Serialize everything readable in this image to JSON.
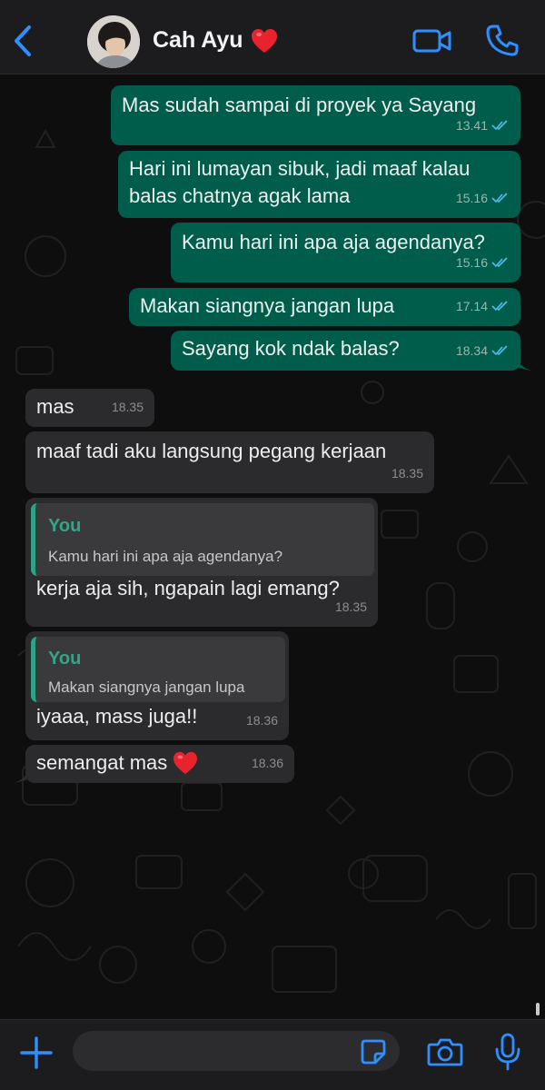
{
  "colors": {
    "accent": "#2e8fff",
    "outgoing_bubble": "#005c4b",
    "incoming_bubble": "#2b2b2d",
    "quote_author": "#35a488",
    "read_ticks": "#53bdeb"
  },
  "header": {
    "contact_name": "Cah Ayu",
    "back_icon": "chevron-left-icon",
    "video_icon": "video-camera-icon",
    "call_icon": "phone-icon"
  },
  "messages": [
    {
      "dir": "out",
      "text": "Mas sudah sampai di proyek ya Sayang",
      "time": "13.41"
    },
    {
      "dir": "out",
      "text": "Hari ini lumayan sibuk, jadi maaf kalau",
      "text2": "balas chatnya agak lama",
      "time": "15.16"
    },
    {
      "dir": "out",
      "text": "Kamu hari ini apa aja agendanya?",
      "time": "15.16"
    },
    {
      "dir": "out",
      "text": "Makan siangnya jangan lupa",
      "time": "17.14"
    },
    {
      "dir": "out",
      "text": "Sayang kok ndak balas?",
      "time": "18.34"
    },
    {
      "dir": "in",
      "text": "mas",
      "time": "18.35"
    },
    {
      "dir": "in",
      "text": "maaf tadi aku langsung pegang kerjaan",
      "time": "18.35"
    },
    {
      "dir": "in",
      "quote_author": "You",
      "quote_text": "Kamu hari ini apa aja agendanya?",
      "text": "kerja aja sih, ngapain lagi emang?",
      "time": "18.35"
    },
    {
      "dir": "in",
      "quote_author": "You",
      "quote_text": "Makan siangnya jangan lupa",
      "text": "iyaaa, mass juga!!",
      "time": "18.36"
    },
    {
      "dir": "in",
      "text": "semangat mas",
      "time": "18.36"
    }
  ],
  "composer": {
    "placeholder": "",
    "plus_icon": "plus-icon",
    "sticker_icon": "sticker-icon",
    "camera_icon": "camera-icon",
    "mic_icon": "microphone-icon"
  }
}
